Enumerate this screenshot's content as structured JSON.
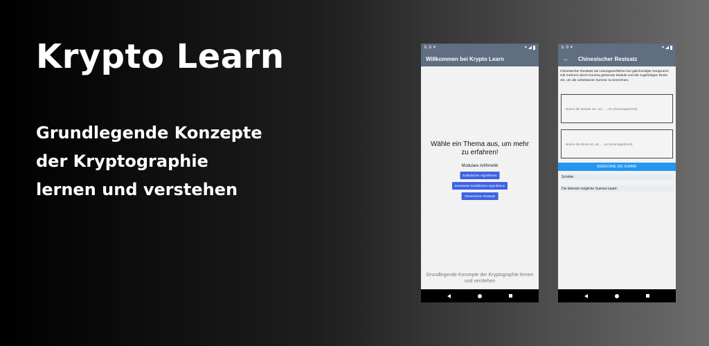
{
  "hero": {
    "title": "Krypto Learn",
    "subtitle": "Grundlegende Konzepte der Kryptographie lernen und verstehen"
  },
  "phone1": {
    "status_left": "b. 8 ☀",
    "app_title": "Willkommen bei Krypto Learn",
    "heading": "Wähle ein Thema aus, um mehr zu erfahren!",
    "section": "Modulare Arithmetik",
    "buttons": [
      "Euklidischer Algorithmus",
      "Erweiterter Euklidischer Algorithmus",
      "Chinesischer Restsatz"
    ],
    "footer": "Grundlegende Konzepte der Kryptographie lernen und verstehen",
    "accent": "#3f63e0"
  },
  "phone2": {
    "status_left": "b. 9 ☀",
    "app_title": "Chinesischer Restsatz",
    "back_icon": "←",
    "description": "Chinesischer Restsatz als Lösungsverfahren bei gleichzeitiger Kongruenz. Gib mehrere durch Komma getrennte Module und die zugehörigen Reste ein, um die unbekannte Summe zu berechnen.",
    "moduli_placeholder": "Nenne die Module m1, m2, ..., mn (kommagetrennt)",
    "remainders_placeholder": "Nenne die Reste a1, a2, ..., an (kommagetrennt)",
    "compute_label": "BERECHNE DIE SUMME",
    "steps_label": "Schritte:",
    "result_label": "Die kleinste mögliche Summe lautet:",
    "accent": "#2196f3"
  },
  "colors": {
    "appbar": "#5f6e80",
    "navbar": "#000000"
  }
}
